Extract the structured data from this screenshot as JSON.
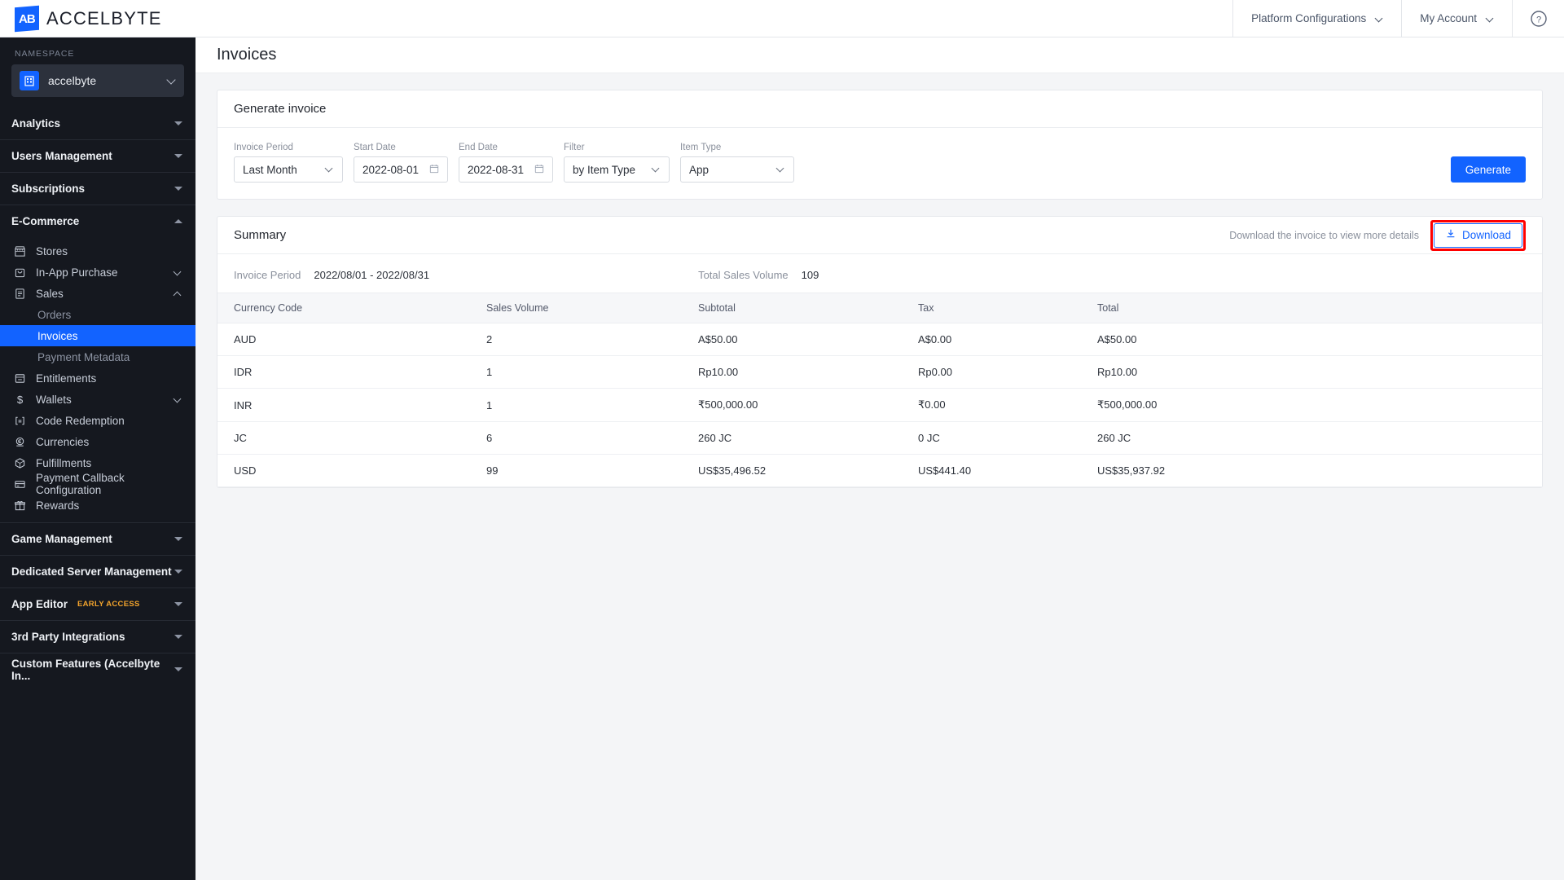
{
  "topbar": {
    "logo_mark": "AB",
    "logo_text": "ACCELBYTE",
    "platform_configurations": "Platform Configurations",
    "my_account": "My Account",
    "help": "?"
  },
  "sidebar": {
    "namespace_label": "NAMESPACE",
    "namespace_value": "accelbyte",
    "sections": [
      {
        "title": "Analytics",
        "expanded": false
      },
      {
        "title": "Users Management",
        "expanded": false
      },
      {
        "title": "Subscriptions",
        "expanded": false
      },
      {
        "title": "E-Commerce",
        "expanded": true
      },
      {
        "title": "Game Management",
        "expanded": false
      },
      {
        "title": "Dedicated Server Management",
        "expanded": false
      },
      {
        "title": "App Editor",
        "expanded": false,
        "badge": "EARLY ACCESS"
      },
      {
        "title": "3rd Party Integrations",
        "expanded": false
      },
      {
        "title": "Custom Features (Accelbyte In...",
        "expanded": false
      }
    ],
    "ecommerce_items": [
      {
        "label": "Stores",
        "icon": "store-icon",
        "chevron": "none"
      },
      {
        "label": "In-App Purchase",
        "icon": "bag-icon",
        "chevron": "down"
      },
      {
        "label": "Sales",
        "icon": "receipt-icon",
        "chevron": "up"
      },
      {
        "label": "Entitlements",
        "icon": "entitlement-icon",
        "chevron": "none"
      },
      {
        "label": "Wallets",
        "icon": "dollar-icon",
        "chevron": "down"
      },
      {
        "label": "Code Redemption",
        "icon": "code-icon",
        "chevron": "none"
      },
      {
        "label": "Currencies",
        "icon": "currency-icon",
        "chevron": "none"
      },
      {
        "label": "Fulfillments",
        "icon": "box-icon",
        "chevron": "none"
      },
      {
        "label": "Payment Callback Configuration",
        "icon": "card-icon",
        "chevron": "none"
      },
      {
        "label": "Rewards",
        "icon": "gift-icon",
        "chevron": "none"
      }
    ],
    "sales_subitems": [
      {
        "label": "Orders",
        "active": false
      },
      {
        "label": "Invoices",
        "active": true
      },
      {
        "label": "Payment Metadata",
        "active": false
      }
    ]
  },
  "page": {
    "title": "Invoices"
  },
  "generate": {
    "card_title": "Generate invoice",
    "invoice_period_label": "Invoice Period",
    "invoice_period_value": "Last Month",
    "start_date_label": "Start Date",
    "start_date_value": "2022-08-01",
    "end_date_label": "End Date",
    "end_date_value": "2022-08-31",
    "filter_label": "Filter",
    "filter_value": "by Item Type",
    "item_type_label": "Item Type",
    "item_type_value": "App",
    "generate_button": "Generate"
  },
  "summary": {
    "card_title": "Summary",
    "download_hint": "Download the invoice to view more details",
    "download_button": "Download",
    "invoice_period_label": "Invoice Period",
    "invoice_period_value": "2022/08/01 - 2022/08/31",
    "total_sales_volume_label": "Total Sales Volume",
    "total_sales_volume_value": "109",
    "columns": [
      "Currency Code",
      "Sales Volume",
      "Subtotal",
      "Tax",
      "Total"
    ],
    "rows": [
      {
        "currency": "AUD",
        "volume": "2",
        "subtotal": "A$50.00",
        "tax": "A$0.00",
        "total": "A$50.00"
      },
      {
        "currency": "IDR",
        "volume": "1",
        "subtotal": "Rp10.00",
        "tax": "Rp0.00",
        "total": "Rp10.00"
      },
      {
        "currency": "INR",
        "volume": "1",
        "subtotal": "₹500,000.00",
        "tax": "₹0.00",
        "total": "₹500,000.00"
      },
      {
        "currency": "JC",
        "volume": "6",
        "subtotal": "260 JC",
        "tax": "0 JC",
        "total": "260 JC"
      },
      {
        "currency": "USD",
        "volume": "99",
        "subtotal": "US$35,496.52",
        "tax": "US$441.40",
        "total": "US$35,937.92"
      }
    ]
  },
  "colors": {
    "accent": "#1263ff",
    "sidebar_bg": "#15181f",
    "highlight_annotation": "#ff0000",
    "early_access_badge": "#f3a42c"
  }
}
